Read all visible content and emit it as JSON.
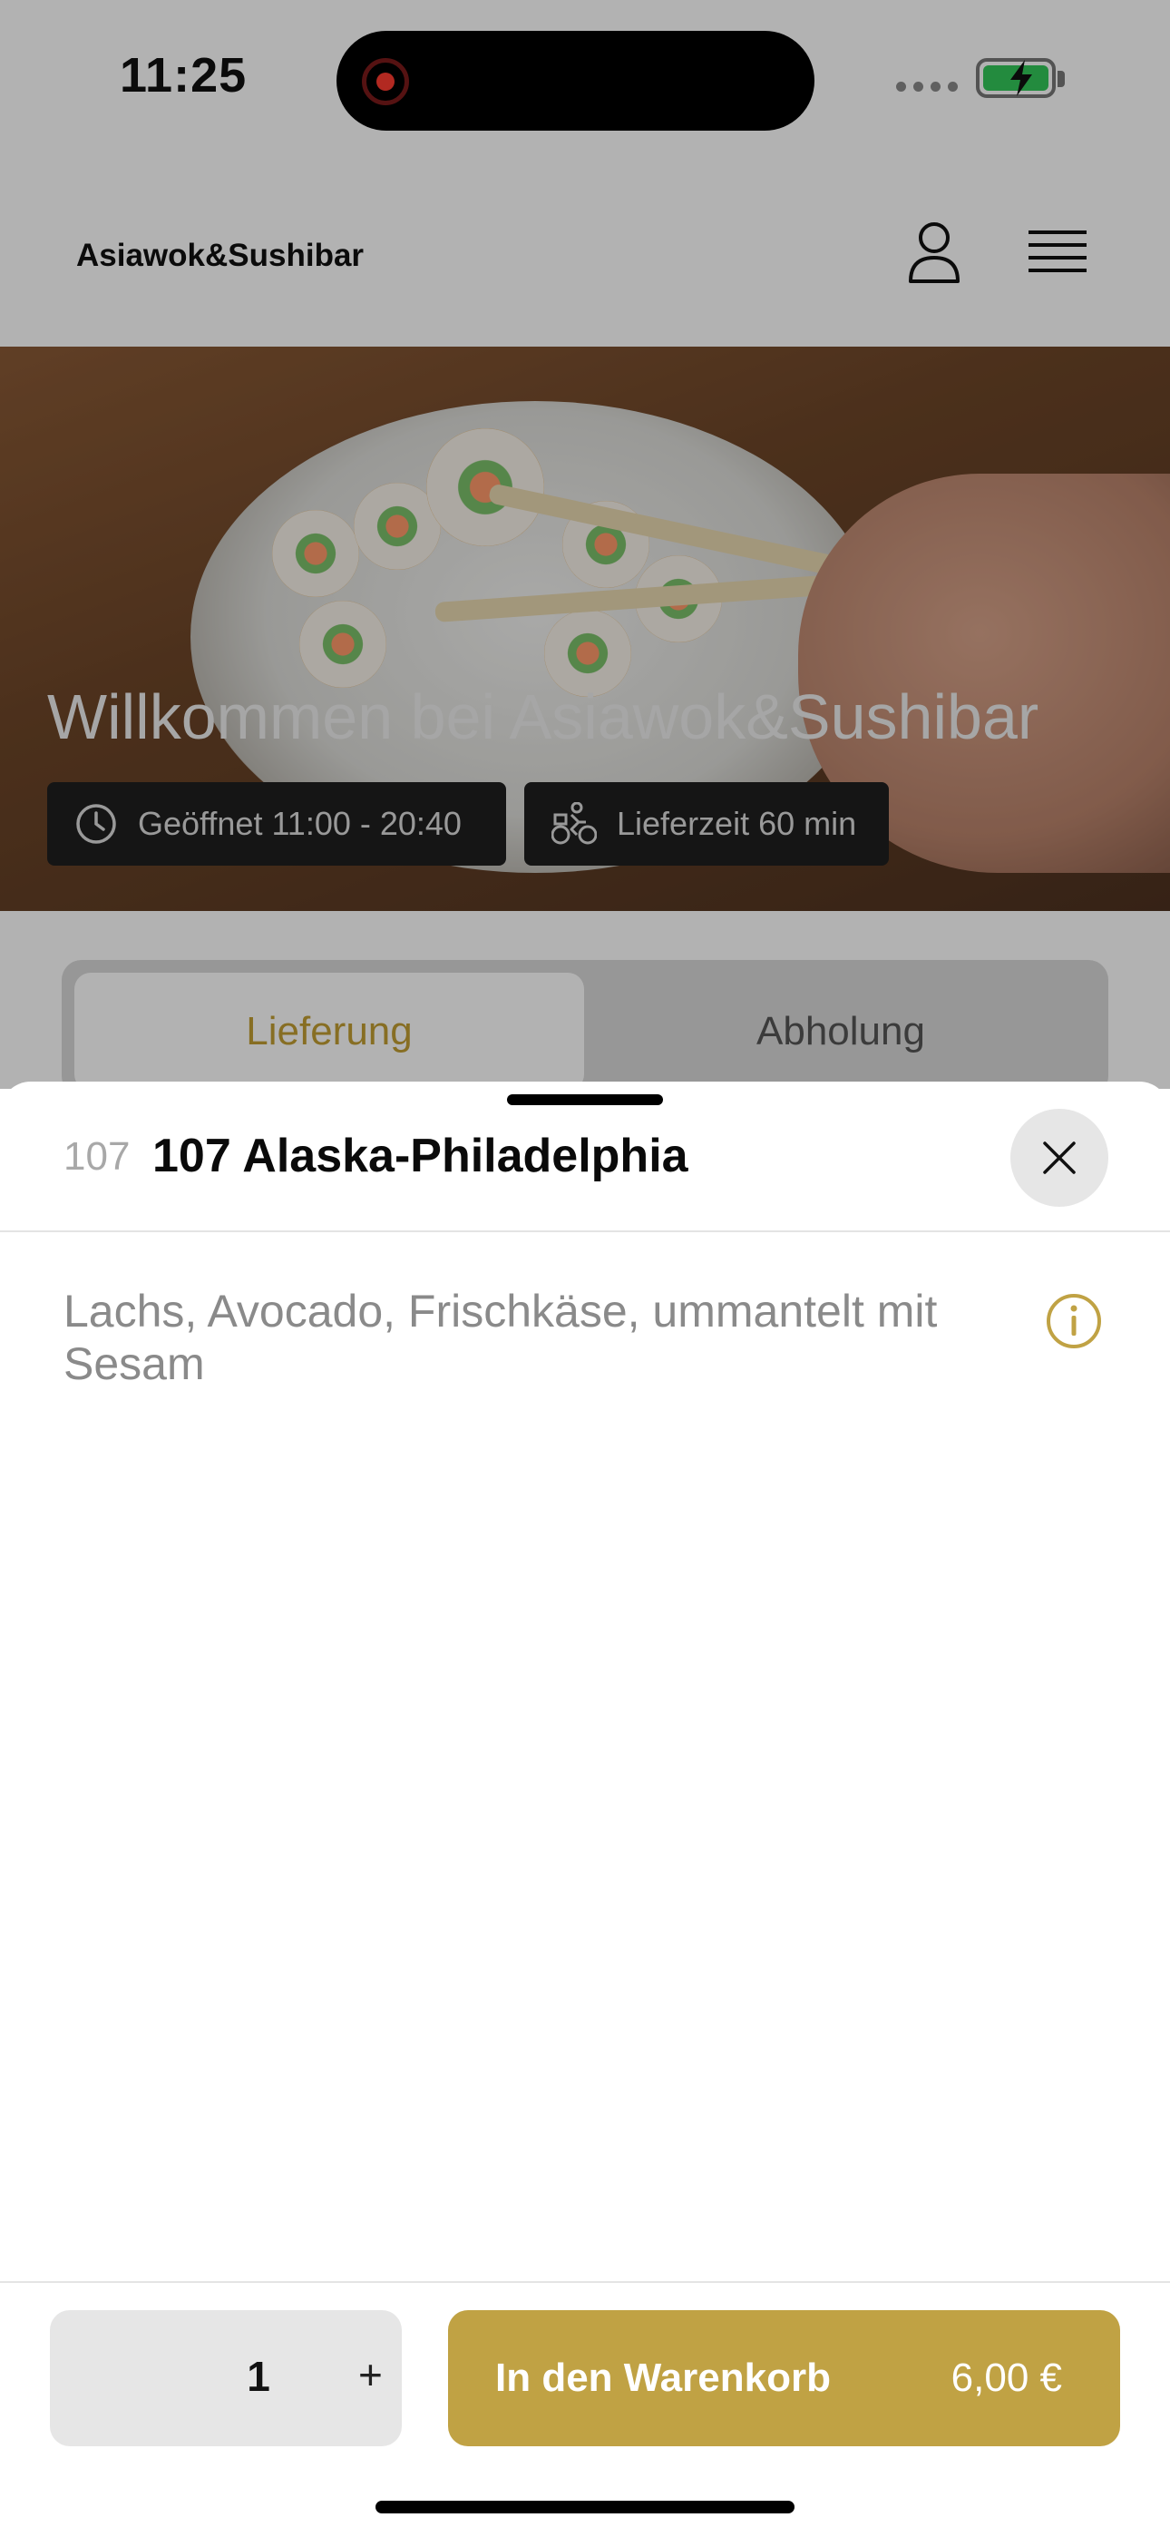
{
  "status_bar": {
    "time": "11:25"
  },
  "header": {
    "brand": "Asiawok&Sushibar"
  },
  "hero": {
    "title": "Willkommen bei Asiawok&Sushibar",
    "opening_hours": "Geöffnet 11:00 - 20:40",
    "delivery_time": "Lieferzeit 60 min"
  },
  "tabs": [
    {
      "label": "Lieferung",
      "selected": true
    },
    {
      "label": "Abholung",
      "selected": false
    }
  ],
  "sheet": {
    "item_number": "107",
    "item_name": "107 Alaska-Philadelphia",
    "description": "Lachs, Avocado, Frischkäse, ummantelt mit Sesam"
  },
  "footer": {
    "quantity": "1",
    "plus": "+",
    "add_to_cart": "In den Warenkorb",
    "price": "6,00 €"
  },
  "colors": {
    "accent": "#c0a244",
    "tab_active_text": "#c29e33",
    "recording": "#ff3b30",
    "battery": "#33c759"
  },
  "icons": [
    "user-icon",
    "menu-icon",
    "clock-icon",
    "bike-icon",
    "close-icon",
    "info-icon",
    "recording-icon",
    "battery-icon"
  ]
}
